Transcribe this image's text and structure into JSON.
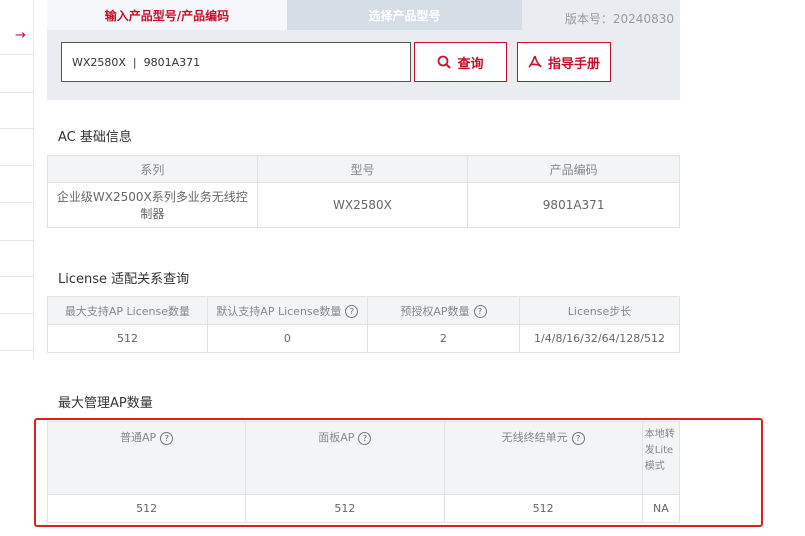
{
  "sidebar": {
    "arrow_icon": "arrow-right-icon"
  },
  "search": {
    "tab_active": "输入产品型号/产品编码",
    "tab_inactive": "选择产品型号",
    "version": "版本号：20240830",
    "input_value": "WX2580X  |  9801A371",
    "query_label": "查询",
    "guide_label": "指导手册"
  },
  "ac_info": {
    "title": "AC 基础信息",
    "headers": [
      "系列",
      "型号",
      "产品编码"
    ],
    "row": [
      "企业级WX2500X系列多业务无线控制器",
      "WX2580X",
      "9801A371"
    ]
  },
  "license": {
    "title": "License 适配关系查询",
    "headers": [
      "最大支持AP License数量",
      "默认支持AP License数量",
      "预授权AP数量",
      "License步长"
    ],
    "row": [
      "512",
      "0",
      "2",
      "1/4/8/16/32/64/128/512"
    ]
  },
  "max_ap": {
    "title": "最大管理AP数量",
    "headers": [
      "普通AP",
      "面板AP",
      "无线终结单元",
      "本地转发Lite模式"
    ],
    "row": [
      "512",
      "512",
      "512",
      "NA"
    ]
  },
  "colors": {
    "accent": "#c8102e",
    "highlight_border": "#e02020"
  }
}
